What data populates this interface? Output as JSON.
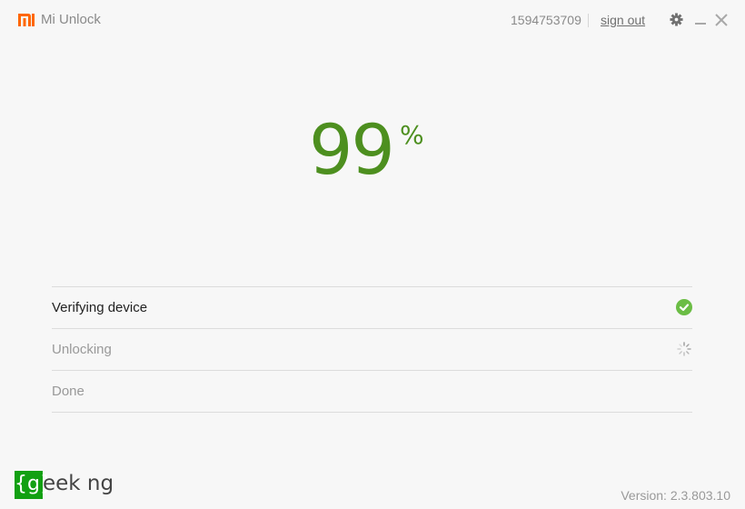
{
  "titlebar": {
    "app_title": "Mi Unlock",
    "account_id": "1594753709",
    "sign_out_label": "sign out",
    "logo_color": "#ff6700"
  },
  "progress": {
    "value": "99",
    "unit": "%",
    "color": "#4d8f1f"
  },
  "steps": [
    {
      "label": "Verifying device",
      "status": "complete",
      "icon": "check-circle-icon"
    },
    {
      "label": "Unlocking",
      "status": "in-progress",
      "icon": "spinner-icon"
    },
    {
      "label": "Done",
      "status": "pending",
      "icon": ""
    }
  ],
  "footer": {
    "brand_box": "{g}",
    "brand_text": "eek ng",
    "version": "Version: 2.3.803.10"
  }
}
